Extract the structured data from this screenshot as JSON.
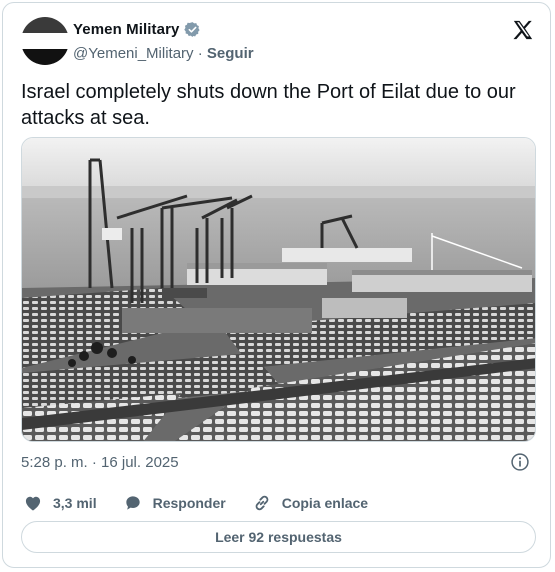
{
  "author": {
    "display_name": "Yemen Military",
    "handle": "@Yemeni_Military",
    "separator": "·",
    "follow_label": "Seguir"
  },
  "post": {
    "text": "Israel completely shuts down the Port of Eilat due to our attacks at sea.",
    "timestamp": "5:28 p. m. · 16 jul. 2025"
  },
  "actions": {
    "likes": "3,3 mil",
    "reply_label": "Responder",
    "copy_link_label": "Copia enlace"
  },
  "replies_button": "Leer 92 respuestas",
  "icons": [
    "x-logo-icon",
    "verified-badge-icon",
    "info-icon",
    "heart-icon",
    "reply-bubble-icon",
    "link-icon"
  ],
  "colors": {
    "text": "#0f1419",
    "secondary": "#536471",
    "border": "#cfd9de"
  }
}
